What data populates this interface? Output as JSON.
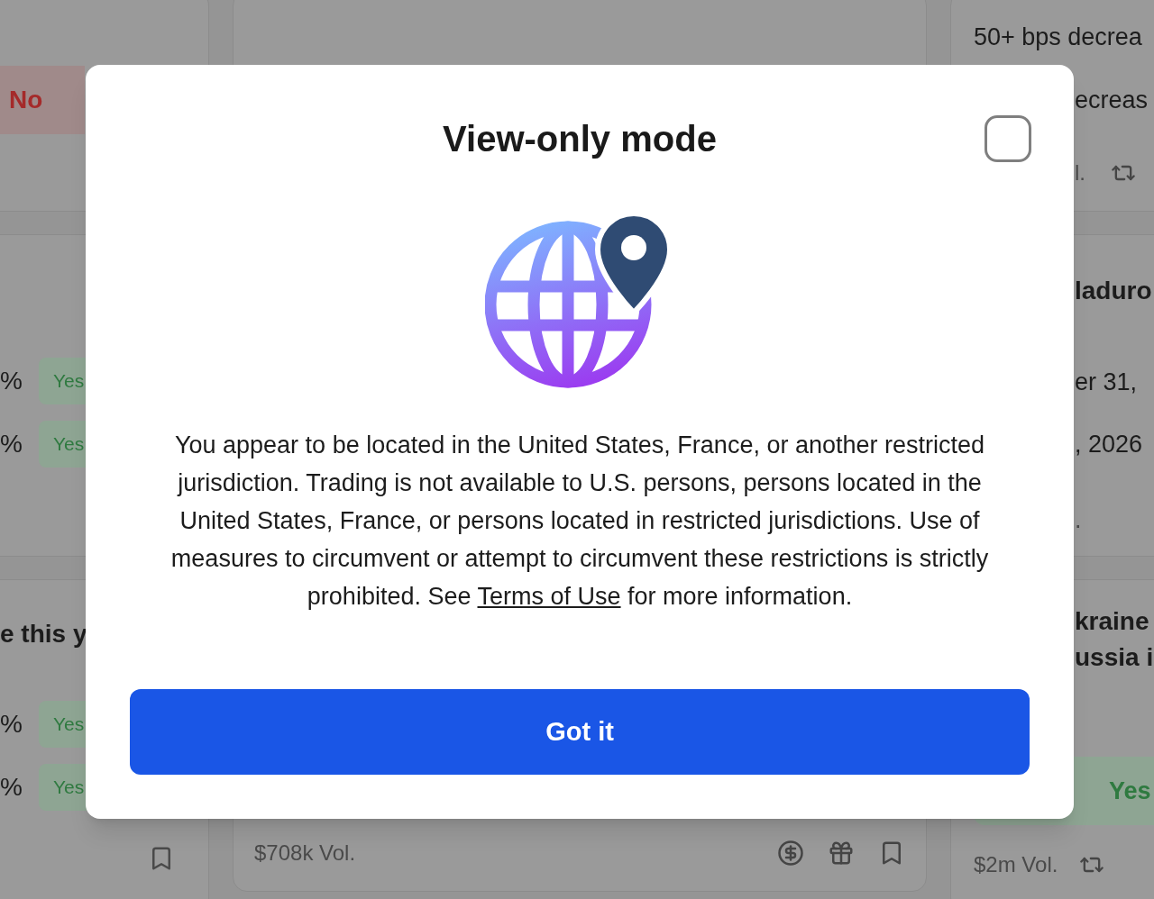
{
  "left_column": {
    "card_1": {
      "outcome_button": {
        "label": "No",
        "kind": "no"
      }
    },
    "card_2": {
      "rows": [
        {
          "percent": "%",
          "outcome_button": {
            "label": "Yes",
            "kind": "yes"
          }
        },
        {
          "percent": "%",
          "outcome_button": {
            "label": "Yes",
            "kind": "yes"
          }
        }
      ]
    },
    "card_3": {
      "title": "e this y",
      "rows": [
        {
          "percent": "%",
          "outcome_button": {
            "label": "Yes",
            "kind": "yes"
          }
        },
        {
          "percent": "%",
          "outcome_button": {
            "label": "Yes",
            "kind": "yes"
          }
        }
      ]
    }
  },
  "middle_column": {
    "volume": "$708k Vol."
  },
  "right_column": {
    "card_1": {
      "lines": [
        "50+ bps decrea",
        "ecreas"
      ],
      "volume": "l."
    },
    "card_2": {
      "title": "laduro",
      "lines": [
        "er 31,",
        ", 2026",
        "."
      ]
    },
    "card_3": {
      "title_lines": [
        "kraine",
        "ussia i"
      ],
      "outcome_button": {
        "label": "Yes",
        "kind": "yes"
      },
      "volume": "$2m Vol."
    }
  },
  "dialog": {
    "title": "View-only mode",
    "message_before": "You appear to be located in the United States, France, or another restricted jurisdiction. Trading is not available to U.S. persons, persons located in the United States, France, or persons located in restricted jurisdictions. Use of measures to circumvent or attempt to circumvent these restrictions is strictly prohibited. See",
    "link": "Terms of Use",
    "message_after": "for more information.",
    "button": "Got it"
  }
}
